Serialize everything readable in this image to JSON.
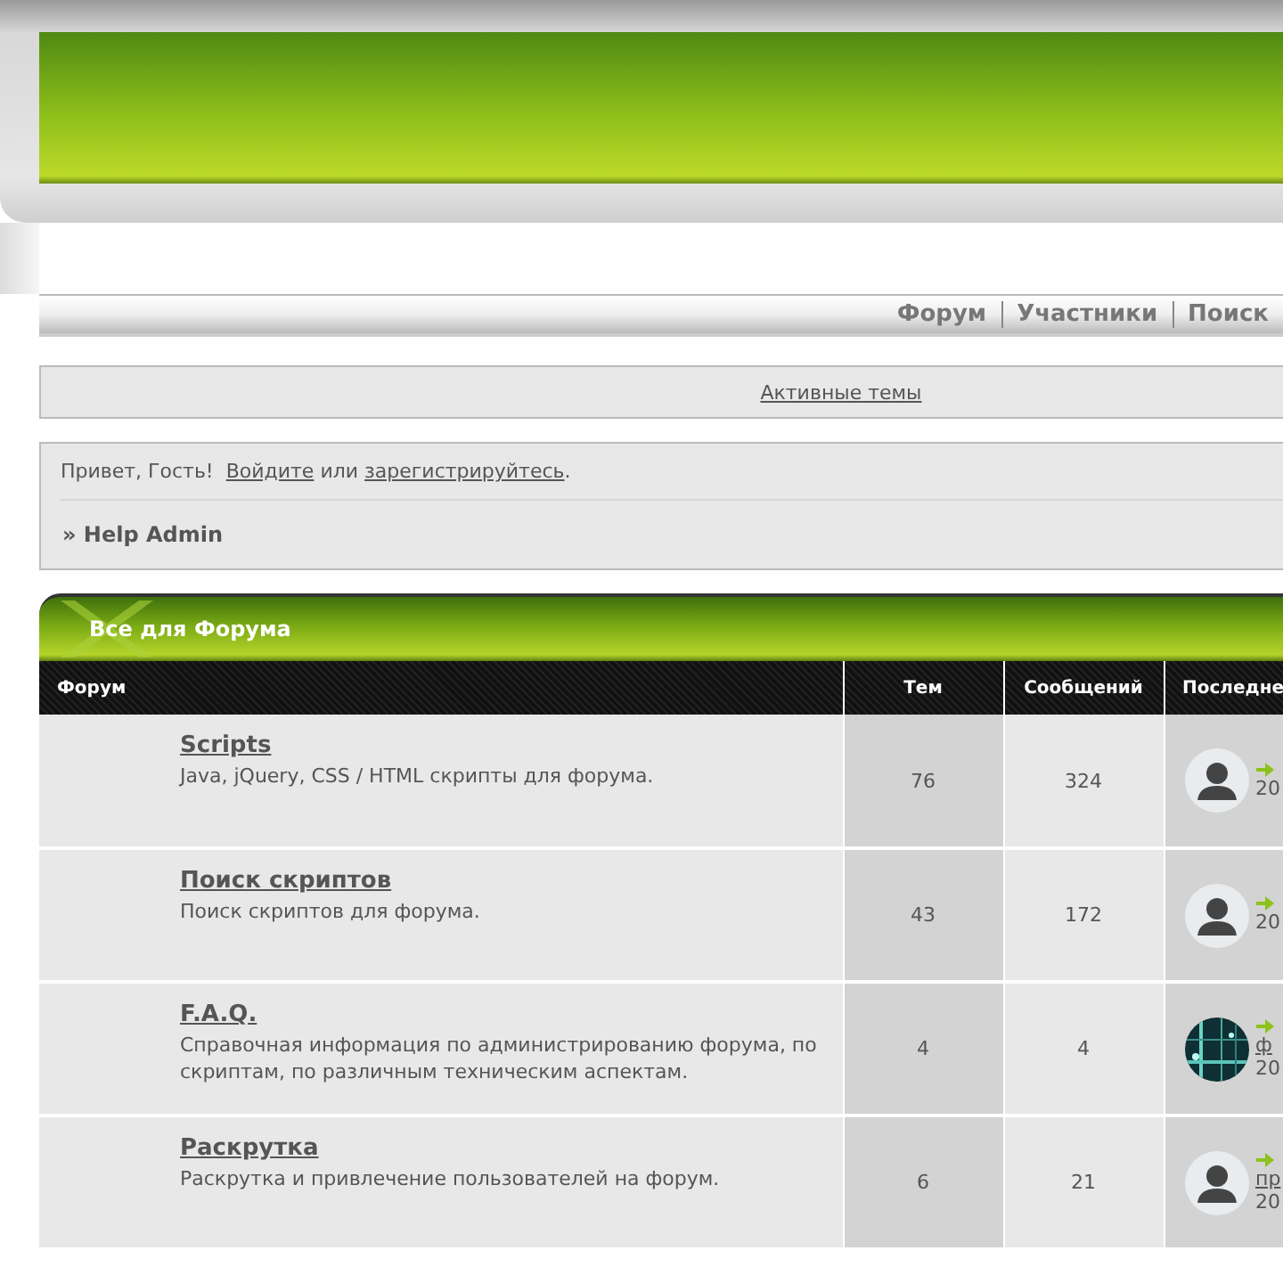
{
  "nav": [
    {
      "label": "Форум"
    },
    {
      "label": "Участники"
    },
    {
      "label": "Поиск"
    }
  ],
  "active_topics": "Активные темы",
  "welcome": {
    "greeting": "Привет, Гость!",
    "login": "Войдите",
    "or": "или",
    "register": "зарегистрируйтесь",
    "end": "."
  },
  "breadcrumb": "» Help Admin",
  "category": {
    "title": "Все для Форума",
    "columns": [
      "Форум",
      "Тем",
      "Сообщений",
      "Последне"
    ],
    "rows": [
      {
        "name": "Scripts",
        "desc": "Java, jQuery, CSS / HTML скрипты для форума.",
        "topics": "76",
        "posts": "324",
        "avatar": {
          "kind": "silhouette"
        },
        "date": "20"
      },
      {
        "name": "Поиск скриптов",
        "desc": "Поиск скриптов для форума.",
        "topics": "43",
        "posts": "172",
        "avatar": {
          "kind": "silhouette"
        },
        "date": "20"
      },
      {
        "name": "F.A.Q.",
        "desc": "Справочная информация по администрированию форума, по скриптам, по различным техническим аспектам.",
        "topics": "4",
        "posts": "4",
        "link": "ф",
        "date": "20"
      },
      {
        "name": "Раскрутка",
        "desc": "Раскрутка и привлечение пользователей на форум.",
        "topics": "6",
        "posts": "21",
        "avatar": {
          "kind": "silhouette"
        },
        "link": "пр",
        "date": "20"
      }
    ]
  }
}
